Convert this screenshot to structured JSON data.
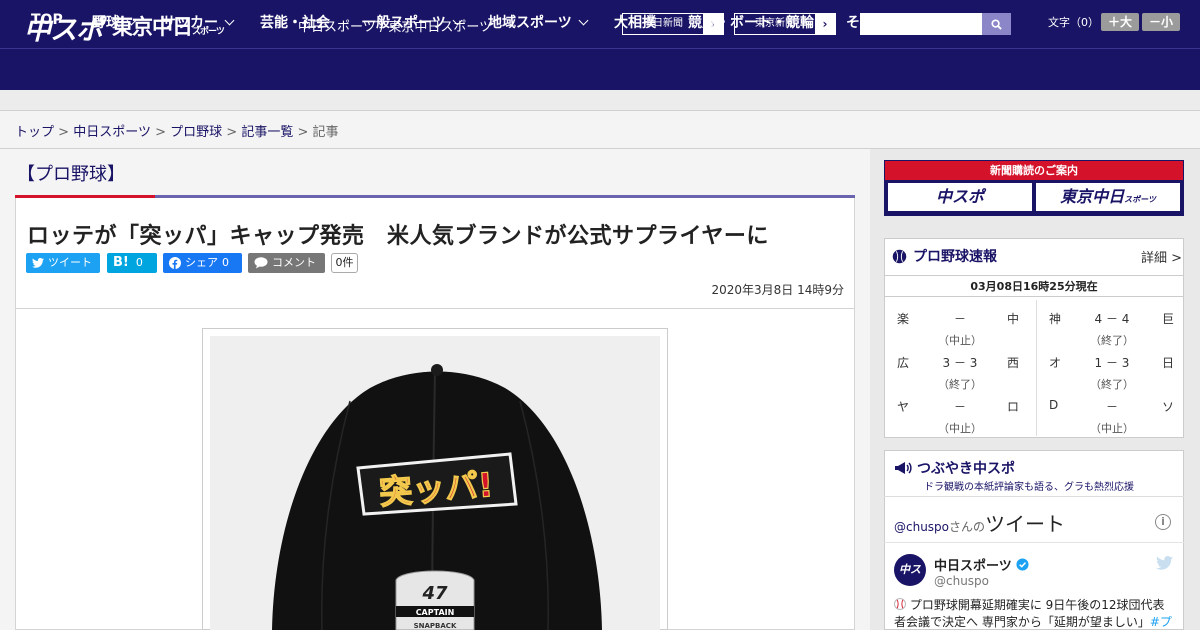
{
  "header": {
    "logo_chuspo": "中スポ",
    "logo_tokyo": "東京中日",
    "logo_tokyo_small": "スポーツ",
    "site_names": "中日スポーツ / 東京中日スポーツ",
    "paper_links": [
      "中日新聞",
      "東京新聞"
    ],
    "search_placeholder": "",
    "font_size_label": "文字（0）",
    "font_larger": "＋大",
    "font_smaller": "－小"
  },
  "nav": {
    "items": [
      {
        "label": "TOP",
        "dropdown": false
      },
      {
        "label": "野球",
        "dropdown": true
      },
      {
        "label": "サッカー",
        "dropdown": true
      },
      {
        "label": "芸能・社会",
        "dropdown": false
      },
      {
        "label": "一般スポーツ",
        "dropdown": true
      },
      {
        "label": "地域スポーツ",
        "dropdown": true
      },
      {
        "label": "大相撲",
        "dropdown": false
      },
      {
        "label": "競馬・ボート・競輪",
        "dropdown": false
      },
      {
        "label": "その他",
        "dropdown": true
      }
    ]
  },
  "breadcrumb": {
    "links": [
      "トップ",
      "中日スポーツ",
      "プロ野球",
      "記事一覧"
    ],
    "separator": ">",
    "current": "記事"
  },
  "article": {
    "category": "【プロ野球】",
    "headline": "ロッテが「突ッパ」キャップ発売　米人気ブランドが公式サプライヤーに",
    "share": {
      "tweet": "ツイート",
      "hatena": "B!",
      "hatena_count": "0",
      "fb": "シェア",
      "fb_count": "0",
      "comment": "コメント",
      "comment_count": "0件"
    },
    "date": "2020年3月8日 14時9分",
    "photo": {
      "logo_text": "突ッパ!",
      "brand": "47",
      "tag1": "CAPTAIN",
      "tag2": "SNAPBACK"
    }
  },
  "sidebar": {
    "subscribe_banner": {
      "title": "新聞購読のご案内",
      "logo1": "中スポ",
      "logo2": "東京中日",
      "logo2_small": "スポーツ"
    },
    "scoreboard": {
      "title": "プロ野球速報",
      "more": "詳細 >",
      "timestamp": "03月08日16時25分現在",
      "games": [
        {
          "team1": "楽",
          "score": "－",
          "team2": "中",
          "status": "（中止）"
        },
        {
          "team1": "神",
          "score": "4 － 4",
          "team2": "巨",
          "status": "（終了）"
        },
        {
          "team1": "広",
          "score": "3 － 3",
          "team2": "西",
          "status": "（終了）"
        },
        {
          "team1": "オ",
          "score": "1 － 3",
          "team2": "日",
          "status": "（終了）"
        },
        {
          "team1": "ヤ",
          "score": "－",
          "team2": "ロ",
          "status": "（中止）"
        },
        {
          "team1": "D",
          "score": "－",
          "team2": "ソ",
          "status": "（中止）"
        }
      ]
    },
    "tweets": {
      "title": "つぶやき中スポ",
      "subtitle": "ドラ観戦の本紙評論家も語る、グラも熱烈応援",
      "widget_handle": "@chuspo",
      "widget_suffix": "さんの",
      "widget_title": "ツイート",
      "info": "i",
      "tweet": {
        "avatar_text": "中スポ",
        "name": "中日スポーツ",
        "handle": "@chuspo",
        "text": "プロ野球開幕延期確実に 9日午後の12球団代表者会議で決定へ 専門家から「延期が望ましい」",
        "hashtag": "#プ"
      }
    }
  },
  "colors": {
    "brand_navy": "#1a1466",
    "accent_red": "#d4122a",
    "accent_purple": "#6a64b0",
    "twitter_blue": "#1da1f2",
    "facebook_blue": "#1877f2",
    "hatena_blue": "#00a4de",
    "comment_gray": "#777777"
  }
}
